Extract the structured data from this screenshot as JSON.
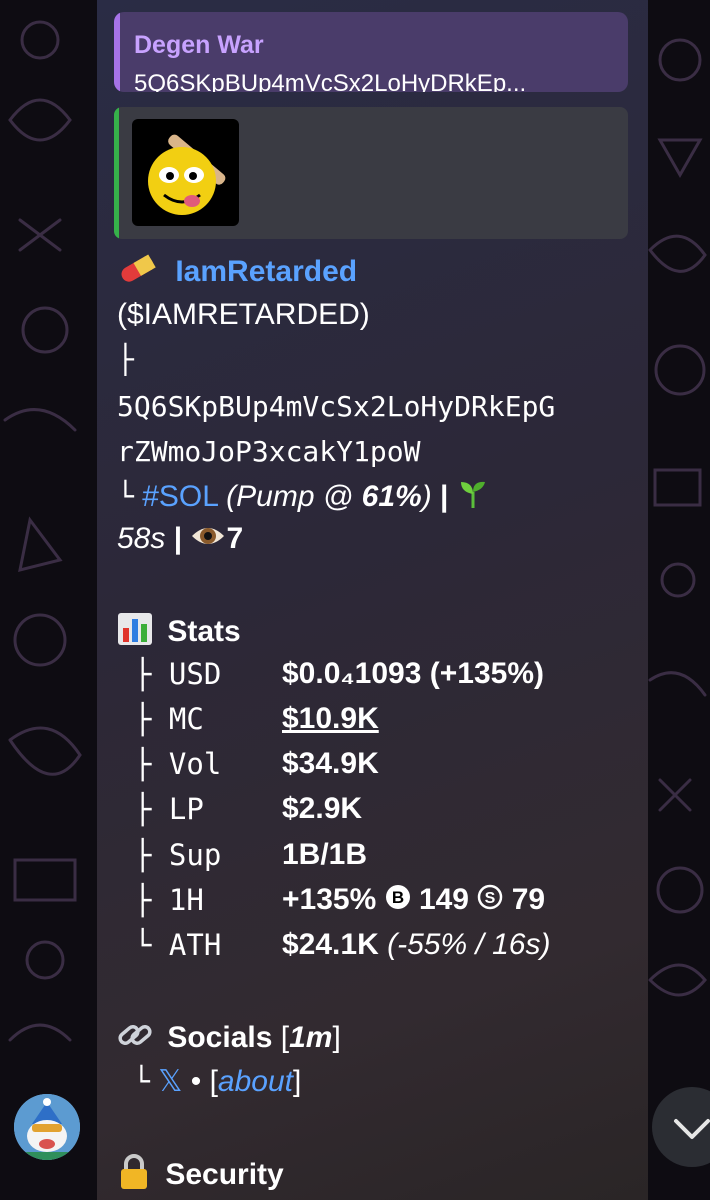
{
  "reply": {
    "title": "Degen War",
    "text": "5Q6SKpBUp4mVcSx2LoHyDRkEp..."
  },
  "token": {
    "name": "IamRetarded",
    "ticker": "($IAMRETARDED)",
    "tree_branch": "├",
    "address_line1": "5Q6SKpBUp4mVcSx2LoHyDRkEpG",
    "address_line2": "rZWmoJoP3xcakY1poW",
    "tree_end": "└",
    "chain": "#SOL",
    "pump_prefix": "(Pump @ ",
    "pump_pct": "61%",
    "pump_suffix": ")",
    "separator": "|",
    "age": "58s",
    "viewers": "7"
  },
  "stats": {
    "header": "Stats",
    "rows": [
      {
        "key": "├ USD",
        "value": "$0.0₄1093 (+135%)"
      },
      {
        "key": "├ MC",
        "value": "$10.9K"
      },
      {
        "key": "├ Vol",
        "value": "$34.9K"
      },
      {
        "key": "├ LP",
        "value": "$2.9K"
      },
      {
        "key": "├ Sup",
        "value": "1B/1B"
      },
      {
        "key": "├ 1H",
        "value_main": "+135%",
        "buys": "149",
        "sells": "79"
      },
      {
        "key": "└ ATH",
        "value_main": "$24.1K",
        "value_note": "(-55% / 16s)"
      }
    ]
  },
  "socials": {
    "header": "Socials",
    "time_open": "[",
    "time": "1m",
    "time_close": "]",
    "tree_end": "└",
    "x_label": "𝕏",
    "bullet": "•",
    "about_open": "[",
    "about": "about",
    "about_close": "]"
  },
  "security": {
    "header": "Security"
  },
  "icons": {
    "pill": "pill-icon",
    "chart": "bar-chart-icon",
    "link": "link-icon",
    "lock": "lock-icon",
    "sprout": "seedling-icon",
    "eye": "eye-icon",
    "buy": "b-circle-icon",
    "sell": "s-circle-icon"
  },
  "colors": {
    "link": "#5aa2ff",
    "reply_accent": "#a673e8",
    "reply_name": "#c8a2ff",
    "preview_accent": "#36b14a"
  }
}
